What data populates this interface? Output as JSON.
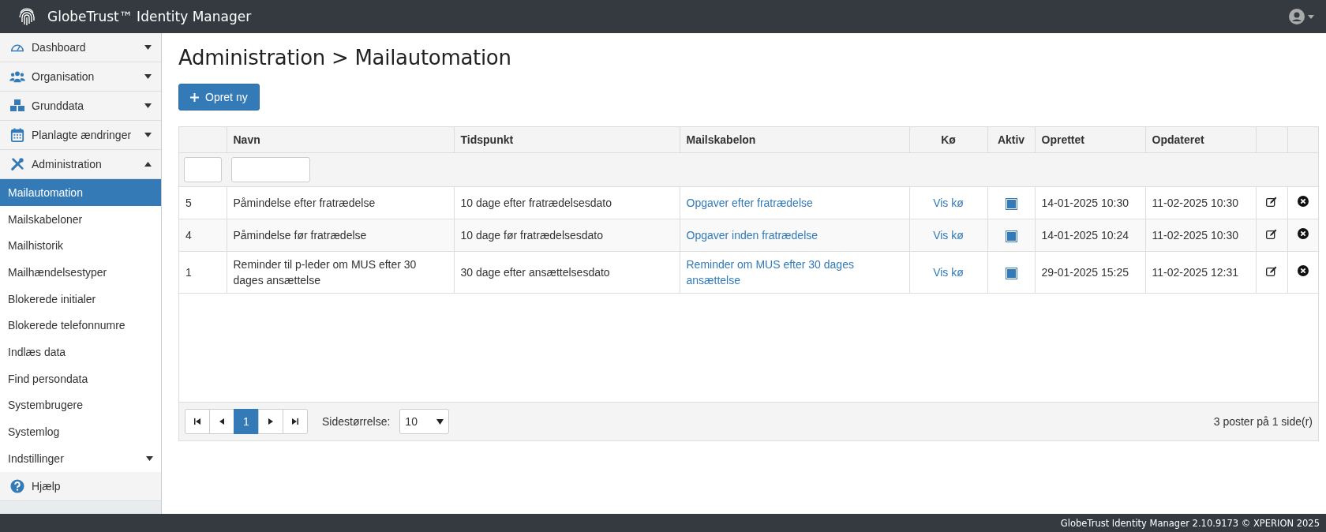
{
  "app_title": "GlobeTrust™ Identity Manager",
  "sidebar": {
    "items": [
      {
        "label": "Dashboard",
        "kind": "group",
        "expanded": false
      },
      {
        "label": "Organisation",
        "kind": "group",
        "expanded": false
      },
      {
        "label": "Grunddata",
        "kind": "group",
        "expanded": false
      },
      {
        "label": "Planlagte ændringer",
        "kind": "group",
        "expanded": false
      },
      {
        "label": "Administration",
        "kind": "group",
        "expanded": true,
        "children": [
          {
            "label": "Mailautomation",
            "selected": true,
            "kind": "link"
          },
          {
            "label": "Mailskabeloner",
            "selected": false,
            "kind": "link"
          },
          {
            "label": "Mailhistorik",
            "selected": false,
            "kind": "link"
          },
          {
            "label": "Mailhændelsestyper",
            "selected": false,
            "kind": "link"
          },
          {
            "label": "Blokerede initialer",
            "selected": false,
            "kind": "link"
          },
          {
            "label": "Blokerede telefonnumre",
            "selected": false,
            "kind": "link"
          },
          {
            "label": "Indlæs data",
            "selected": false,
            "kind": "link"
          },
          {
            "label": "Find persondata",
            "selected": false,
            "kind": "link"
          },
          {
            "label": "Systembrugere",
            "selected": false,
            "kind": "link"
          },
          {
            "label": "Systemlog",
            "selected": false,
            "kind": "link"
          },
          {
            "label": "Indstillinger",
            "selected": false,
            "kind": "submenu",
            "expanded": false
          }
        ]
      },
      {
        "label": "Hjælp",
        "kind": "help"
      }
    ]
  },
  "page_title": "Administration > Mailautomation",
  "create_button": "Opret ny",
  "table": {
    "columns": [
      "",
      "Navn",
      "Tidspunkt",
      "Mailskabelon",
      "Kø",
      "Aktiv",
      "Oprettet",
      "Opdateret",
      "",
      ""
    ],
    "rows": [
      {
        "id": "5",
        "name": "Påmindelse efter fratrædelse",
        "timing": "10 dage efter fratrædelsesdato",
        "template": "Opgaver efter fratrædelse",
        "queue": "Vis kø",
        "active": true,
        "created": "14-01-2025 10:30",
        "updated": "11-02-2025 10:30"
      },
      {
        "id": "4",
        "name": "Påmindelse før fratrædelse",
        "timing": "10 dage før fratrædelsesdato",
        "template": "Opgaver inden fratrædelse",
        "queue": "Vis kø",
        "active": true,
        "created": "14-01-2025 10:24",
        "updated": "11-02-2025 10:30"
      },
      {
        "id": "1",
        "name": "Reminder til p-leder om MUS efter 30 dages ansættelse",
        "timing": "30 dage efter ansættelsesdato",
        "template": "Reminder om MUS efter 30 dages ansættelse",
        "queue": "Vis kø",
        "active": true,
        "created": "29-01-2025 15:25",
        "updated": "11-02-2025 12:31"
      }
    ]
  },
  "pager": {
    "pages": [
      {
        "label": "1",
        "selected": true
      }
    ],
    "page_size_label": "Sidestørrelse:",
    "page_size": "10",
    "summary": "3 poster på 1 side(r)"
  },
  "footer": "GlobeTrust Identity Manager 2.10.9173 © XPERION 2025"
}
